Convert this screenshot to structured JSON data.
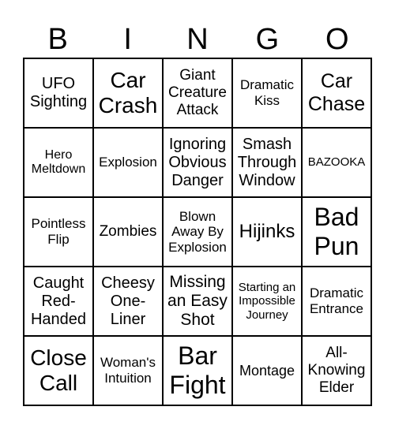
{
  "title_letters": [
    "B",
    "I",
    "N",
    "G",
    "O"
  ],
  "cells": [
    [
      "UFO Sighting",
      "Car Crash",
      "Giant Creature Attack",
      "Dramatic Kiss",
      "Car Chase"
    ],
    [
      "Hero Meltdown",
      "Explosion",
      "Ignoring Obvious Danger",
      "Smash Through Window",
      "BAZOOKA"
    ],
    [
      "Pointless Flip",
      "Zombies",
      "Blown Away By Explosion",
      "Hijinks",
      "Bad Pun"
    ],
    [
      "Caught Red-Handed",
      "Cheesy One-Liner",
      "Missing an Easy Shot",
      "Starting an Impossible Journey",
      "Dramatic Entrance"
    ],
    [
      "Close Call",
      "Woman's Intuition",
      "Bar Fight",
      "Montage",
      "All-Knowing Elder"
    ]
  ]
}
